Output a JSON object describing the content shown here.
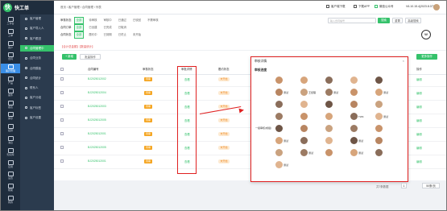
{
  "app": {
    "name": "快工单",
    "logo_char": "快"
  },
  "rail": [
    {
      "label": "工作台",
      "active": false
    },
    {
      "label": "工单",
      "active": false
    },
    {
      "label": "客户",
      "active": false
    },
    {
      "label": "合同",
      "active": false
    },
    {
      "label": "客户管理",
      "active": true
    },
    {
      "label": "产品",
      "active": false
    },
    {
      "label": "备件",
      "active": false
    },
    {
      "label": "报表",
      "active": false
    },
    {
      "label": "库存",
      "active": false
    },
    {
      "label": "结算",
      "active": false
    },
    {
      "label": "消息",
      "active": false
    },
    {
      "label": "知识库",
      "active": false
    },
    {
      "label": "应用",
      "active": false
    },
    {
      "label": "设置",
      "active": false
    },
    {
      "label": "帮助",
      "active": false
    },
    {
      "label": "我的",
      "active": false
    }
  ],
  "submenu": [
    {
      "label": "客户管理",
      "active": false
    },
    {
      "label": "客户导入人",
      "active": false
    },
    {
      "label": "客户跟进",
      "active": false
    },
    {
      "label": "合同管理中",
      "active": true
    },
    {
      "label": "合同业务",
      "active": false
    },
    {
      "label": "合同模板",
      "active": false
    },
    {
      "label": "合同统计",
      "active": false
    },
    {
      "label": "联系人",
      "active": false
    },
    {
      "label": "客户分组",
      "active": false
    },
    {
      "label": "客户标签",
      "active": false
    },
    {
      "label": "客户设置",
      "active": false
    }
  ],
  "breadcrumb": [
    "首页",
    "客户管理",
    "合同管理",
    "列表"
  ],
  "topbar": {
    "download_label": "客户端下载",
    "app_label": "下载APP",
    "service_label": "微信公众号",
    "version": "V6.10.15.4(2023.8.07)"
  },
  "filters": {
    "rows": [
      {
        "label": "审核状态",
        "tags": [
          {
            "text": "全部",
            "on": true
          },
          "待审核",
          "审核中",
          "已通过",
          "已驳回",
          "不需审核"
        ]
      },
      {
        "label": "合同订单",
        "tags": [
          {
            "text": "全部",
            "on": true
          },
          "已创建",
          "已完成",
          "已取消"
        ]
      },
      {
        "label": "合同状态",
        "tags": [
          {
            "text": "全部",
            "on": true
          },
          "履约中",
          "已到期",
          "已终止",
          "未开始"
        ]
      }
    ],
    "search_placeholder": "输入合同编号",
    "search_button": "搜索",
    "reset_button": "重置",
    "filter_button": "高级搜索"
  },
  "summary": "【合计总金额】【数量统计】",
  "toolbar": {
    "new_button": "+ 新增",
    "batch_button": "批量操作",
    "more_button": "更多操作"
  },
  "table": {
    "headers": [
      "合同编号",
      "审核状态",
      "审批详情",
      "履约状态",
      "操作"
    ],
    "rows": [
      {
        "code": "BJ2025012002",
        "status": "待审",
        "audit": "查看",
        "perform": "未开始",
        "action": "编辑"
      },
      {
        "code": "BJ2025012004",
        "status": "待审",
        "audit": "查看",
        "perform": "未开始",
        "action": "编辑"
      },
      {
        "code": "BJ2025012003",
        "status": "待审",
        "audit": "查看",
        "perform": "未开始",
        "action": "编辑"
      },
      {
        "code": "BJ2025012005",
        "status": "待审",
        "audit": "查看",
        "perform": "未开始",
        "action": "编辑"
      },
      {
        "code": "BJ2025012001",
        "status": "待审",
        "audit": "查看",
        "perform": "未开始",
        "action": "编辑"
      },
      {
        "code": "BJ2025012005",
        "status": "待审",
        "audit": "查看",
        "perform": "未开始",
        "action": "编辑"
      },
      {
        "code": "BJ2025012001",
        "status": "待审",
        "audit": "查看",
        "perform": "未开始",
        "action": "编辑"
      }
    ]
  },
  "modal": {
    "title": "审核详情",
    "subtitle": "审核进度",
    "group_label": "一级审核(成组)",
    "users": [
      "",
      "",
      "",
      "",
      "",
      "测试",
      "王经理",
      "测试",
      "",
      "测试",
      "",
      "",
      "",
      "",
      "",
      "",
      "",
      "",
      "TWK",
      "测试",
      "",
      "",
      "",
      "",
      "",
      "测试",
      "",
      "",
      "测试",
      "",
      "",
      "测试",
      "",
      "测试",
      "",
      "测试"
    ]
  },
  "pager": {
    "total": "共7条数据",
    "page": "1",
    "size": "50条/页"
  },
  "colors": {
    "accent": "#35c26b",
    "highlight": "#e02020",
    "warning": "#f5a623",
    "sidebar": "#1f2d3d"
  }
}
